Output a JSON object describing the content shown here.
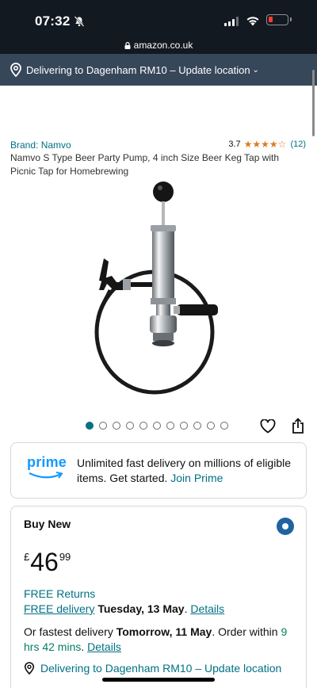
{
  "status_bar": {
    "time": "07:32"
  },
  "browser": {
    "url": "amazon.co.uk"
  },
  "location_bar": {
    "text": "Delivering to Dagenham RM10 – Update location",
    "chevron": "⌄"
  },
  "product": {
    "brand": "Brand: Namvo",
    "rating": {
      "score": "3.7",
      "stars": "★★★★☆",
      "count": "(12)"
    },
    "title": "Namvo S Type Beer Party Pump, 4 inch Size Beer Keg Tap with Picnic Tap for Homebrewing"
  },
  "carousel": {
    "total_images": 11,
    "active_index": 0
  },
  "prime": {
    "logo": "prime",
    "text": "Unlimited fast delivery on millions of eligible items. Get started.",
    "link": "Join Prime"
  },
  "buy_box": {
    "title": "Buy New",
    "price": {
      "currency": "£",
      "whole": "46",
      "fraction": "99"
    },
    "returns": "FREE Returns",
    "delivery_link": "FREE delivery",
    "delivery_date": "Tuesday, 13 May",
    "delivery_period": ".",
    "details_link": "Details",
    "fastest_prefix": "Or fastest delivery",
    "fastest_date": "Tomorrow, 11 May",
    "order_within": ". Order within",
    "countdown": "9 hrs 42 mins",
    "fastest_period": ".",
    "fastest_details": "Details",
    "location": "Delivering to Dagenham RM10 – Update location"
  },
  "colors": {
    "header": "#131921",
    "location_bar": "#37475a",
    "link": "#007185",
    "star": "#de7921",
    "prime_blue": "#1399ff",
    "radio": "#2162a1",
    "green": "#067d62"
  }
}
